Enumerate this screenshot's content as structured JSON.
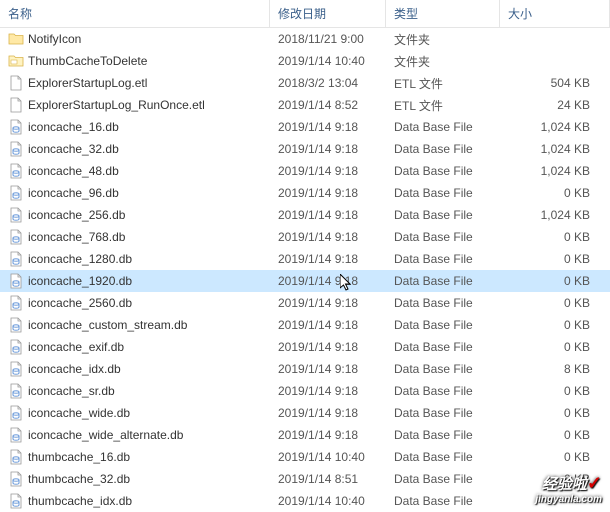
{
  "columns": {
    "name": "名称",
    "date": "修改日期",
    "type": "类型",
    "size": "大小"
  },
  "rows": [
    {
      "icon": "folder",
      "name": "NotifyIcon",
      "date": "2018/11/21 9:00",
      "type": "文件夹",
      "size": "",
      "selected": false
    },
    {
      "icon": "folder-alt",
      "name": "ThumbCacheToDelete",
      "date": "2019/1/14 10:40",
      "type": "文件夹",
      "size": "",
      "selected": false
    },
    {
      "icon": "file",
      "name": "ExplorerStartupLog.etl",
      "date": "2018/3/2 13:04",
      "type": "ETL 文件",
      "size": "504 KB",
      "selected": false
    },
    {
      "icon": "file",
      "name": "ExplorerStartupLog_RunOnce.etl",
      "date": "2019/1/14 8:52",
      "type": "ETL 文件",
      "size": "24 KB",
      "selected": false
    },
    {
      "icon": "db",
      "name": "iconcache_16.db",
      "date": "2019/1/14 9:18",
      "type": "Data Base File",
      "size": "1,024 KB",
      "selected": false
    },
    {
      "icon": "db",
      "name": "iconcache_32.db",
      "date": "2019/1/14 9:18",
      "type": "Data Base File",
      "size": "1,024 KB",
      "selected": false
    },
    {
      "icon": "db",
      "name": "iconcache_48.db",
      "date": "2019/1/14 9:18",
      "type": "Data Base File",
      "size": "1,024 KB",
      "selected": false
    },
    {
      "icon": "db",
      "name": "iconcache_96.db",
      "date": "2019/1/14 9:18",
      "type": "Data Base File",
      "size": "0 KB",
      "selected": false
    },
    {
      "icon": "db",
      "name": "iconcache_256.db",
      "date": "2019/1/14 9:18",
      "type": "Data Base File",
      "size": "1,024 KB",
      "selected": false
    },
    {
      "icon": "db",
      "name": "iconcache_768.db",
      "date": "2019/1/14 9:18",
      "type": "Data Base File",
      "size": "0 KB",
      "selected": false
    },
    {
      "icon": "db",
      "name": "iconcache_1280.db",
      "date": "2019/1/14 9:18",
      "type": "Data Base File",
      "size": "0 KB",
      "selected": false
    },
    {
      "icon": "db",
      "name": "iconcache_1920.db",
      "date": "2019/1/14 9:18",
      "type": "Data Base File",
      "size": "0 KB",
      "selected": true
    },
    {
      "icon": "db",
      "name": "iconcache_2560.db",
      "date": "2019/1/14 9:18",
      "type": "Data Base File",
      "size": "0 KB",
      "selected": false
    },
    {
      "icon": "db",
      "name": "iconcache_custom_stream.db",
      "date": "2019/1/14 9:18",
      "type": "Data Base File",
      "size": "0 KB",
      "selected": false
    },
    {
      "icon": "db",
      "name": "iconcache_exif.db",
      "date": "2019/1/14 9:18",
      "type": "Data Base File",
      "size": "0 KB",
      "selected": false
    },
    {
      "icon": "db",
      "name": "iconcache_idx.db",
      "date": "2019/1/14 9:18",
      "type": "Data Base File",
      "size": "8 KB",
      "selected": false
    },
    {
      "icon": "db",
      "name": "iconcache_sr.db",
      "date": "2019/1/14 9:18",
      "type": "Data Base File",
      "size": "0 KB",
      "selected": false
    },
    {
      "icon": "db",
      "name": "iconcache_wide.db",
      "date": "2019/1/14 9:18",
      "type": "Data Base File",
      "size": "0 KB",
      "selected": false
    },
    {
      "icon": "db",
      "name": "iconcache_wide_alternate.db",
      "date": "2019/1/14 9:18",
      "type": "Data Base File",
      "size": "0 KB",
      "selected": false
    },
    {
      "icon": "db",
      "name": "thumbcache_16.db",
      "date": "2019/1/14 10:40",
      "type": "Data Base File",
      "size": "0 KB",
      "selected": false
    },
    {
      "icon": "db",
      "name": "thumbcache_32.db",
      "date": "2019/1/14 8:51",
      "type": "Data Base File",
      "size": "0 KB",
      "selected": false
    },
    {
      "icon": "db",
      "name": "thumbcache_idx.db",
      "date": "2019/1/14 10:40",
      "type": "Data Base File",
      "size": "",
      "selected": false
    }
  ],
  "watermark": {
    "main": "经验啦",
    "check": "✓",
    "sub": "jingyanla.com"
  }
}
